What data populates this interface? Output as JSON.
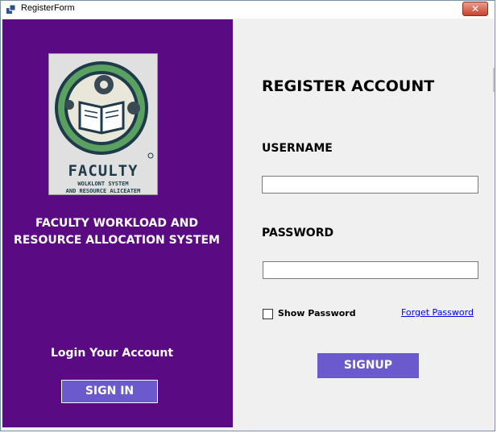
{
  "window": {
    "title": "RegisterForm",
    "close_label": "✕"
  },
  "left": {
    "logo": {
      "title": "FACULTY",
      "sub1": "WOLKLONT SYSTEM",
      "sub2": "AND RESOURCE ALICEATEM"
    },
    "system_title_line1": "FACULTY WORKLOAD AND",
    "system_title_line2": "RESOURCE ALLOCATION SYSTEM",
    "login_heading": "Login Your Account",
    "signin_label": "SIGN IN"
  },
  "right": {
    "title": "REGISTER ACCOUNT",
    "username_label": "USERNAME",
    "username_value": "",
    "password_label": "PASSWORD",
    "password_value": "",
    "show_password_label": "Show Password",
    "forget_password_label": "Forget Password",
    "signup_label": "SIGNUP"
  },
  "colors": {
    "panel": "#5a0b83",
    "button": "#6a5acd"
  }
}
